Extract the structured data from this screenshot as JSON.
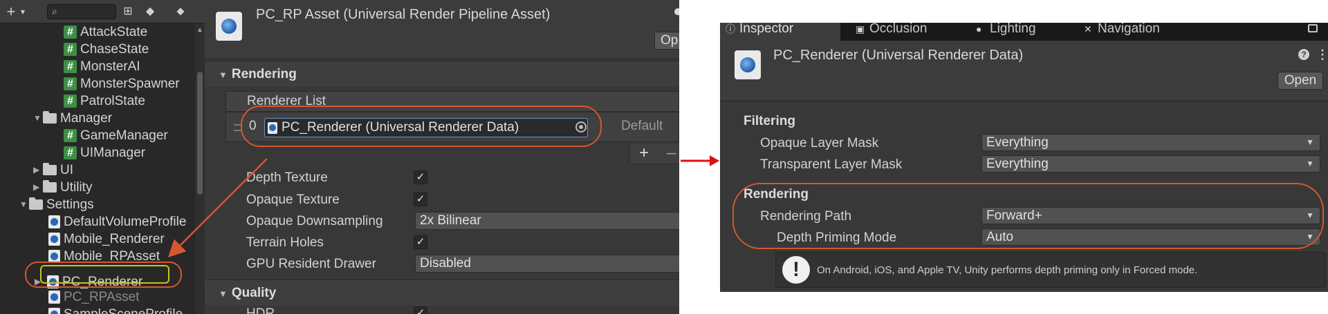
{
  "project_window": {
    "toolbar": {
      "add_label": "+",
      "add_caret": "▾",
      "search_placeholder": ""
    },
    "tree": [
      {
        "label": "AttackState",
        "type": "script",
        "depth": 2
      },
      {
        "label": "ChaseState",
        "type": "script",
        "depth": 2
      },
      {
        "label": "MonsterAI",
        "type": "script",
        "depth": 2
      },
      {
        "label": "MonsterSpawner",
        "type": "script",
        "depth": 2
      },
      {
        "label": "PatrolState",
        "type": "script",
        "depth": 2
      },
      {
        "label": "Manager",
        "type": "folder-open",
        "depth": 1
      },
      {
        "label": "GameManager",
        "type": "script",
        "depth": 2
      },
      {
        "label": "UIManager",
        "type": "script",
        "depth": 2
      },
      {
        "label": "UI",
        "type": "folder",
        "depth": 1
      },
      {
        "label": "Utility",
        "type": "folder",
        "depth": 1
      },
      {
        "label": "Settings",
        "type": "folder-open",
        "depth": 0
      },
      {
        "label": "DefaultVolumeProfile",
        "type": "asset",
        "depth": 1
      },
      {
        "label": "Mobile_Renderer",
        "type": "asset",
        "depth": 1
      },
      {
        "label": "Mobile_RPAsset",
        "type": "asset",
        "depth": 1
      },
      {
        "label": "PC_Renderer",
        "type": "asset",
        "depth": 1
      },
      {
        "label": "PC_RPAsset",
        "type": "asset",
        "depth": 1
      },
      {
        "label": "SampleSceneProfile",
        "type": "asset",
        "depth": 1
      }
    ]
  },
  "urp_inspector": {
    "title": "PC_RP Asset (Universal Render Pipeline Asset)",
    "open_label": "Op",
    "rendering": {
      "header": "Rendering",
      "renderer_list_label": "Renderer List",
      "item_index": "0",
      "renderer_value": "PC_Renderer (Universal Renderer Data)",
      "default_label": "Default",
      "add_label": "+",
      "remove_label": "–",
      "properties": [
        {
          "label": "Depth Texture",
          "kind": "checkbox",
          "checked": true
        },
        {
          "label": "Opaque Texture",
          "kind": "checkbox",
          "checked": true
        },
        {
          "label": "Opaque Downsampling",
          "kind": "dropdown",
          "value": "2x Bilinear"
        },
        {
          "label": "Terrain Holes",
          "kind": "checkbox",
          "checked": true
        },
        {
          "label": "GPU Resident Drawer",
          "kind": "dropdown",
          "value": "Disabled"
        }
      ]
    },
    "quality": {
      "header": "Quality",
      "first_label": "HDR"
    }
  },
  "renderer_inspector": {
    "tabs": [
      {
        "label": "Inspector",
        "icon": "info-icon",
        "active": true
      },
      {
        "label": "Occlusion",
        "icon": "occlusion-icon",
        "active": false
      },
      {
        "label": "Lighting",
        "icon": "light-bulb-icon",
        "active": false
      },
      {
        "label": "Navigation",
        "icon": "navigation-icon",
        "active": false
      }
    ],
    "title": "PC_Renderer (Universal Renderer Data)",
    "open_label": "Open",
    "filtering": {
      "header": "Filtering",
      "opaque_label": "Opaque Layer Mask",
      "opaque_value": "Everything",
      "transparent_label": "Transparent Layer Mask",
      "transparent_value": "Everything"
    },
    "rendering": {
      "header": "Rendering",
      "path_label": "Rendering Path",
      "path_value": "Forward+",
      "depth_label": "Depth Priming Mode",
      "depth_value": "Auto"
    },
    "help_text": "On Android, iOS, and Apple TV, Unity performs depth priming only in Forced mode."
  },
  "colors": {
    "annotation": "#d6572f",
    "highlight": "#c7c41c",
    "transition_arrow": "#e01010"
  }
}
